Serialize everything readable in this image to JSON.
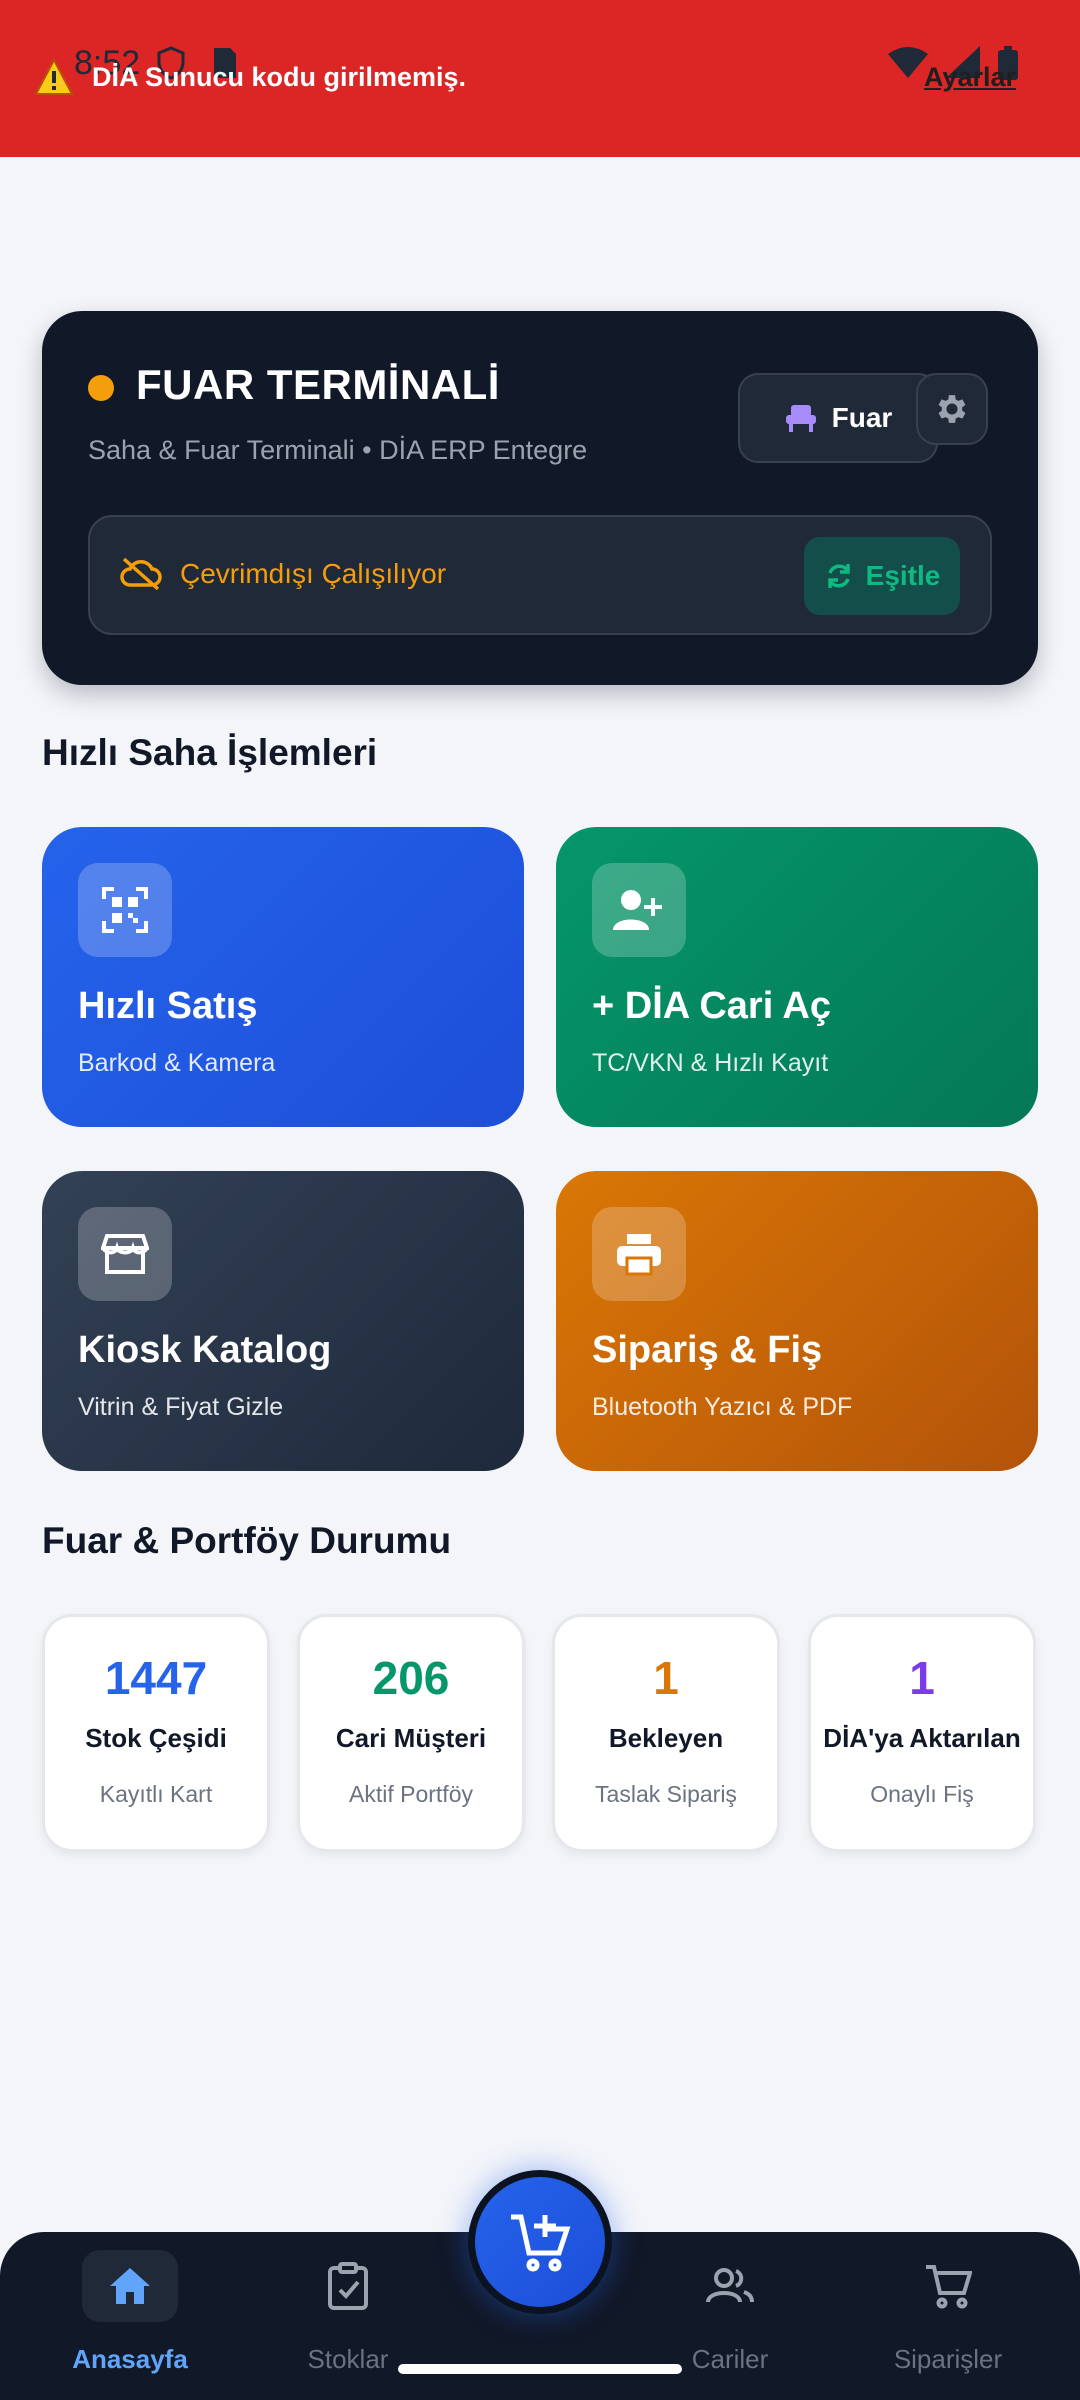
{
  "status_bar": {
    "time": "8:52"
  },
  "banner": {
    "message": "DİA Sunucu kodu girilmemiş.",
    "settings_link": "Ayarlar"
  },
  "header": {
    "title": "FUAR TERMİNALİ",
    "subtitle": "Saha & Fuar Terminali • DİA ERP Entegre",
    "mode_button": "Fuar",
    "offline_text": "Çevrimdışı Çalışılıyor",
    "sync_button": "Eşitle"
  },
  "quick_actions": {
    "title": "Hızlı Saha İşlemleri",
    "items": [
      {
        "title": "Hızlı Satış",
        "subtitle": "Barkod & Kamera",
        "icon": "qr-scan-icon"
      },
      {
        "title": "+ DİA Cari Aç",
        "subtitle": "TC/VKN & Hızlı Kayıt",
        "icon": "add-user-icon"
      },
      {
        "title": "Kiosk Katalog",
        "subtitle": "Vitrin & Fiyat Gizle",
        "icon": "store-icon"
      },
      {
        "title": "Sipariş & Fiş",
        "subtitle": "Bluetooth Yazıcı & PDF",
        "icon": "printer-icon"
      }
    ]
  },
  "portfolio": {
    "title": "Fuar & Portföy Durumu",
    "stats": [
      {
        "value": "1447",
        "label": "Stok Çeşidi",
        "sub": "Kayıtlı Kart",
        "color": "#2563eb"
      },
      {
        "value": "206",
        "label": "Cari Müşteri",
        "sub": "Aktif Portföy",
        "color": "#059669"
      },
      {
        "value": "1",
        "label": "Bekleyen",
        "sub": "Taslak Sipariş",
        "color": "#d97706"
      },
      {
        "value": "1",
        "label": "DİA'ya Aktarılan",
        "sub": "Onaylı Fiş",
        "color": "#7c3aed"
      }
    ]
  },
  "bottom_nav": {
    "items": [
      {
        "label": "Anasayfa",
        "icon": "home-icon",
        "active": true
      },
      {
        "label": "Stoklar",
        "icon": "clipboard-check-icon",
        "active": false
      },
      {
        "label": "Cariler",
        "icon": "users-icon",
        "active": false
      },
      {
        "label": "Siparişler",
        "icon": "cart-icon",
        "active": false
      }
    ],
    "fab_icon": "add-to-cart-icon"
  },
  "colors": {
    "banner": "#dc2626",
    "header_bg": "#111827",
    "accent_orange": "#f59e0b",
    "accent_green": "#10b981",
    "nav_active": "#60a5fa"
  }
}
